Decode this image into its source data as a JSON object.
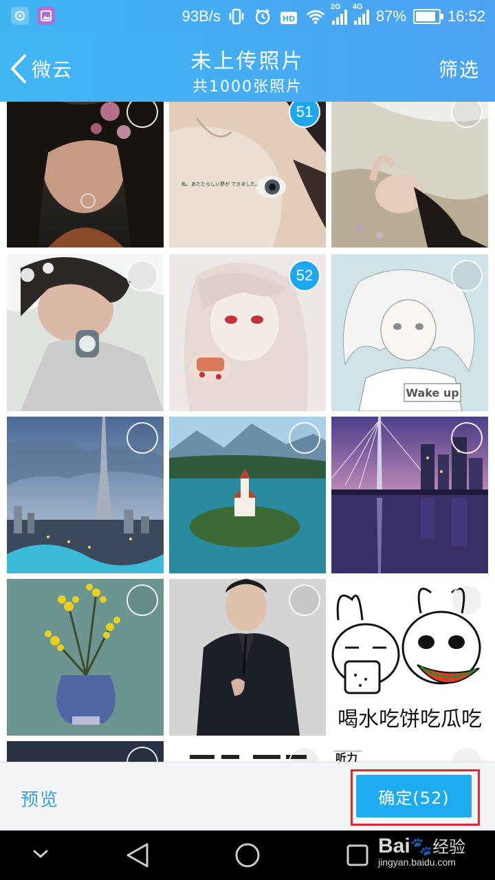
{
  "statusbar": {
    "speed": "93B/s",
    "net_2g": "2G",
    "net_4g": "4G",
    "battery_pct": "87%",
    "battery_level": 0.87,
    "time": "16:52"
  },
  "header": {
    "back_label": "微云",
    "title": "未上传照片",
    "subtitle": "共1000张照片",
    "filter_label": "筛选"
  },
  "grid": {
    "tiles": [
      {
        "icon": "portrait-photo",
        "badge": ""
      },
      {
        "icon": "closeup-face-photo",
        "badge": "51"
      },
      {
        "icon": "portrait-photo",
        "badge": ""
      },
      {
        "icon": "portrait-photo",
        "badge": ""
      },
      {
        "icon": "anime-illustration",
        "badge": "52"
      },
      {
        "icon": "anime-illustration",
        "badge": ""
      },
      {
        "icon": "city-skyline-photo",
        "badge": ""
      },
      {
        "icon": "lake-island-photo",
        "badge": ""
      },
      {
        "icon": "city-bridge-night-photo",
        "badge": ""
      },
      {
        "icon": "flower-vase-photo",
        "badge": ""
      },
      {
        "icon": "man-suit-photo",
        "badge": ""
      },
      {
        "icon": "cartoon-meme",
        "badge": ""
      },
      {
        "icon": "partial-photo",
        "badge": ""
      },
      {
        "icon": "partial-photo",
        "badge": ""
      },
      {
        "icon": "partial-photo",
        "badge": ""
      }
    ],
    "closeup_caption": "私、あたたらしい夢が できました。",
    "anime_text": "Wake up",
    "meme_text": "喝水吃饼吃瓜吃",
    "partial_text": "听力"
  },
  "bottom": {
    "preview_label": "预览",
    "confirm_label": "确定(52)"
  },
  "watermark": {
    "brand": "Bai",
    "brand_cn": "经验",
    "url": "jingyan.baidu.com"
  },
  "colors": {
    "accent": "#1eabf0",
    "header": "#45aef3",
    "highlight": "#e5262a"
  }
}
